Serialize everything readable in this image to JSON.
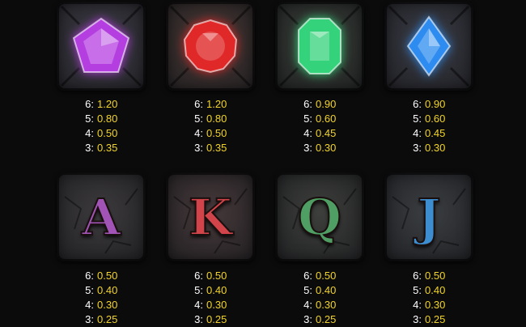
{
  "symbols": [
    {
      "name": "purple-gem",
      "type": "gem",
      "tile_color": "#3f3e48",
      "gem_color": "#b43ee0",
      "payouts": [
        {
          "count": "6:",
          "value": "1.20"
        },
        {
          "count": "5:",
          "value": "0.80"
        },
        {
          "count": "4:",
          "value": "0.50"
        },
        {
          "count": "3:",
          "value": "0.35"
        }
      ]
    },
    {
      "name": "red-gem",
      "type": "gem",
      "tile_color": "#4a3a36",
      "gem_color": "#e02828",
      "payouts": [
        {
          "count": "6:",
          "value": "1.20"
        },
        {
          "count": "5:",
          "value": "0.80"
        },
        {
          "count": "4:",
          "value": "0.50"
        },
        {
          "count": "3:",
          "value": "0.35"
        }
      ]
    },
    {
      "name": "green-gem",
      "type": "gem",
      "tile_color": "#3a4039",
      "gem_color": "#34d27a",
      "payouts": [
        {
          "count": "6:",
          "value": "0.90"
        },
        {
          "count": "5:",
          "value": "0.60"
        },
        {
          "count": "4:",
          "value": "0.45"
        },
        {
          "count": "3:",
          "value": "0.30"
        }
      ]
    },
    {
      "name": "blue-gem",
      "type": "gem",
      "tile_color": "#3b3d47",
      "gem_color": "#2e8cf0",
      "payouts": [
        {
          "count": "6:",
          "value": "0.90"
        },
        {
          "count": "5:",
          "value": "0.60"
        },
        {
          "count": "4:",
          "value": "0.45"
        },
        {
          "count": "3:",
          "value": "0.30"
        }
      ]
    },
    {
      "name": "letter-a",
      "type": "letter",
      "letter": "A",
      "tile_color": "#3c3a3c",
      "letter_color": "#a154b5",
      "payouts": [
        {
          "count": "6:",
          "value": "0.50"
        },
        {
          "count": "5:",
          "value": "0.40"
        },
        {
          "count": "4:",
          "value": "0.30"
        },
        {
          "count": "3:",
          "value": "0.25"
        }
      ]
    },
    {
      "name": "letter-k",
      "type": "letter",
      "letter": "K",
      "tile_color": "#46393a",
      "letter_color": "#d1454a",
      "payouts": [
        {
          "count": "6:",
          "value": "0.50"
        },
        {
          "count": "5:",
          "value": "0.40"
        },
        {
          "count": "4:",
          "value": "0.30"
        },
        {
          "count": "3:",
          "value": "0.25"
        }
      ]
    },
    {
      "name": "letter-q",
      "type": "letter",
      "letter": "Q",
      "tile_color": "#3d3f3c",
      "letter_color": "#4f9e63",
      "payouts": [
        {
          "count": "6:",
          "value": "0.50"
        },
        {
          "count": "5:",
          "value": "0.40"
        },
        {
          "count": "4:",
          "value": "0.30"
        },
        {
          "count": "3:",
          "value": "0.25"
        }
      ]
    },
    {
      "name": "letter-j",
      "type": "letter",
      "letter": "J",
      "tile_color": "#3b3e42",
      "letter_color": "#3c8ed0",
      "payouts": [
        {
          "count": "6:",
          "value": "0.50"
        },
        {
          "count": "5:",
          "value": "0.40"
        },
        {
          "count": "4:",
          "value": "0.30"
        },
        {
          "count": "3:",
          "value": "0.25"
        }
      ]
    }
  ]
}
